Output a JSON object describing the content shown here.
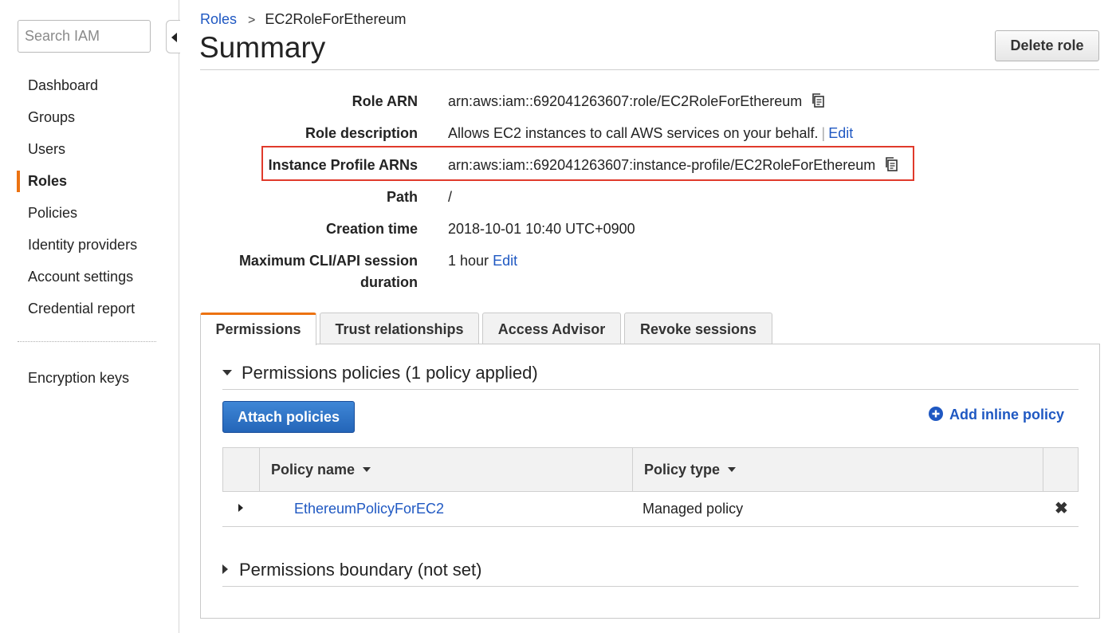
{
  "sidebar": {
    "search_placeholder": "Search IAM",
    "items": [
      {
        "label": "Dashboard"
      },
      {
        "label": "Groups"
      },
      {
        "label": "Users"
      },
      {
        "label": "Roles",
        "active": true
      },
      {
        "label": "Policies"
      },
      {
        "label": "Identity providers"
      },
      {
        "label": "Account settings"
      },
      {
        "label": "Credential report"
      }
    ],
    "extra_items": [
      {
        "label": "Encryption keys"
      }
    ]
  },
  "breadcrumb": {
    "parent": "Roles",
    "separator": ">",
    "current": "EC2RoleForEthereum"
  },
  "page": {
    "title": "Summary",
    "delete_label": "Delete role"
  },
  "summary": {
    "role_arn": {
      "label": "Role ARN",
      "value": "arn:aws:iam::692041263607:role/EC2RoleForEthereum"
    },
    "role_description": {
      "label": "Role description",
      "value": "Allows EC2 instances to call AWS services on your behalf.",
      "separator": "|",
      "edit": "Edit"
    },
    "instance_profile": {
      "label": "Instance Profile ARNs",
      "value": "arn:aws:iam::692041263607:instance-profile/EC2RoleForEthereum"
    },
    "path": {
      "label": "Path",
      "value": "/"
    },
    "creation_time": {
      "label": "Creation time",
      "value": "2018-10-01 10:40 UTC+0900"
    },
    "max_session": {
      "label_line1": "Maximum CLI/API session",
      "label_line2": "duration",
      "value": "1 hour",
      "edit": "Edit"
    }
  },
  "tabs": [
    {
      "label": "Permissions",
      "active": true
    },
    {
      "label": "Trust relationships"
    },
    {
      "label": "Access Advisor"
    },
    {
      "label": "Revoke sessions"
    }
  ],
  "permissions": {
    "policies_header": "Permissions policies (1 policy applied)",
    "attach_label": "Attach policies",
    "add_inline_label": "Add inline policy",
    "table": {
      "columns": [
        "Policy name",
        "Policy type"
      ],
      "rows": [
        {
          "name": "EthereumPolicyForEC2",
          "type": "Managed policy",
          "remove": "✖"
        }
      ]
    },
    "boundary_header": "Permissions boundary (not set)"
  },
  "colors": {
    "accent_orange": "#ec7211",
    "link_blue": "#1f58c2",
    "highlight_red": "#e03a2b",
    "primary_button": "#2465b8"
  }
}
